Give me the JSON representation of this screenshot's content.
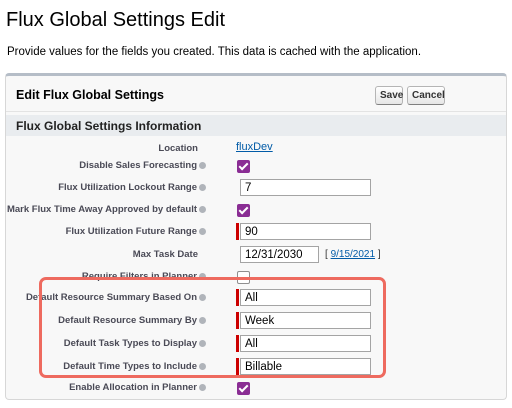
{
  "page": {
    "title": "Flux Global Settings Edit",
    "description": "Provide values for the fields you created. This data is cached with the application."
  },
  "block": {
    "title": "Edit Flux Global Settings",
    "save_label": "Save",
    "cancel_label": "Cancel",
    "section_title": "Flux Global Settings Information"
  },
  "fields": {
    "location": {
      "label": "Location",
      "value": "fluxDev"
    },
    "disable_sales_forecasting": {
      "label": "Disable Sales Forecasting",
      "checked": true
    },
    "lockout_range": {
      "label": "Flux Utilization Lockout Range",
      "value": "7"
    },
    "mark_time_away": {
      "label": "Mark Flux Time Away Approved by default",
      "checked": true
    },
    "future_range": {
      "label": "Flux Utilization Future Range",
      "value": "90"
    },
    "max_task_date": {
      "label": "Max Task Date",
      "value": "12/31/2030",
      "today_link": "9/15/2021",
      "bracket_open": "[",
      "bracket_close": "]"
    },
    "require_filters": {
      "label": "Require Filters in Planner",
      "checked": false
    },
    "resource_summary_based_on": {
      "label": "Default Resource Summary Based On",
      "value": "All"
    },
    "resource_summary_by": {
      "label": "Default Resource Summary By",
      "value": "Week"
    },
    "task_types": {
      "label": "Default Task Types to Display",
      "value": "All"
    },
    "time_types": {
      "label": "Default Time Types to Include",
      "value": "Billable"
    },
    "enable_allocation": {
      "label": "Enable Allocation in Planner",
      "checked": true
    }
  },
  "colors": {
    "checkbox": "#8a2d94",
    "required": "#cc0000",
    "highlight": "#ee6a5f",
    "link": "#015ba7"
  }
}
